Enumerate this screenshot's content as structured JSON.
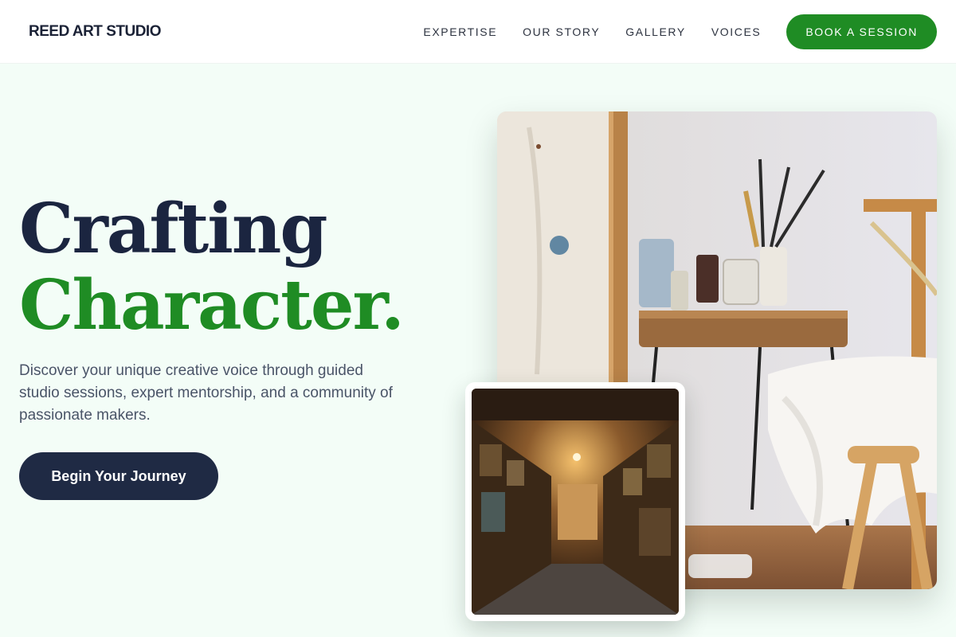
{
  "header": {
    "brand": "REED ART STUDIO",
    "nav": [
      {
        "label": "EXPERTISE"
      },
      {
        "label": "OUR STORY"
      },
      {
        "label": "GALLERY"
      },
      {
        "label": "VOICES"
      }
    ],
    "cta_label": "BOOK A SESSION"
  },
  "hero": {
    "headline_line1": "Crafting",
    "headline_line2": "Character.",
    "description": "Discover your unique creative voice through guided studio sessions, expert mentorship, and a community of passionate makers.",
    "cta_label": "Begin Your Journey"
  },
  "colors": {
    "accent_green": "#1f8c24",
    "navy": "#1f2a44",
    "background": "#f3fdf7"
  }
}
